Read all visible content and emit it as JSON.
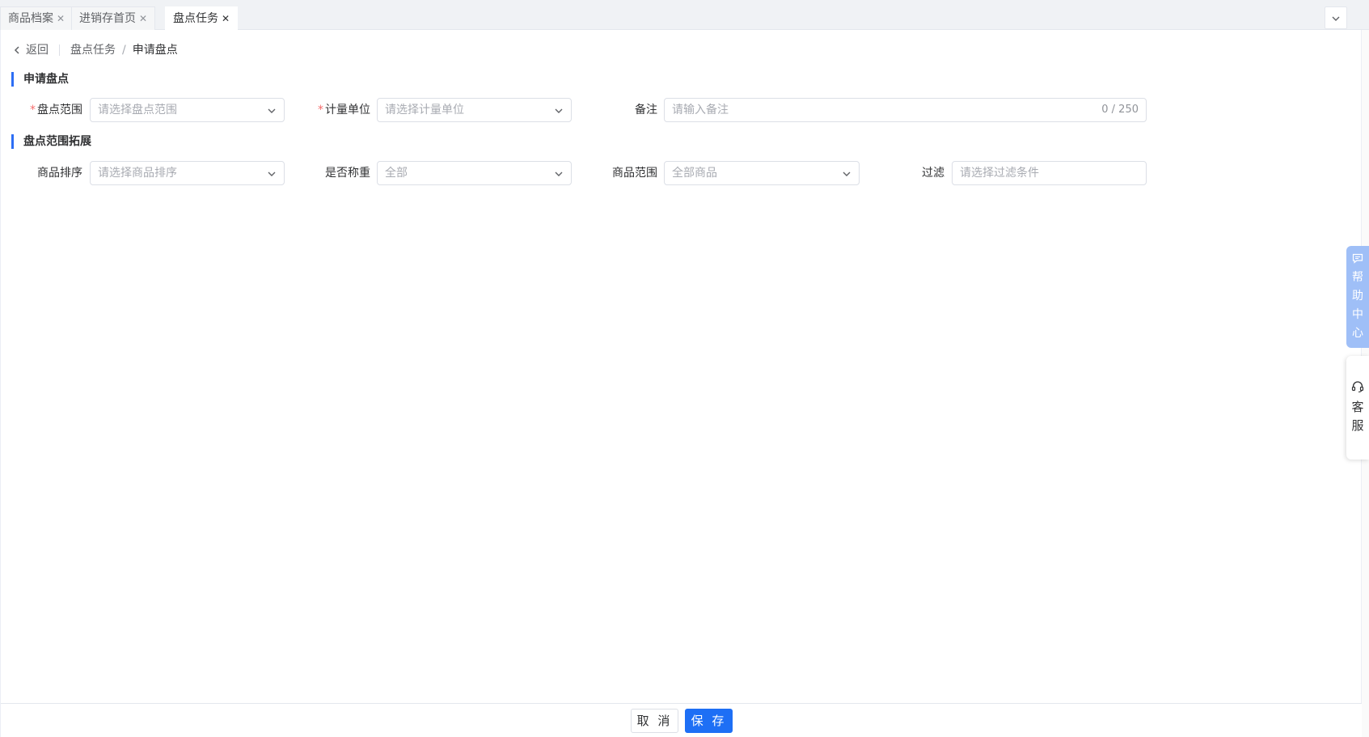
{
  "tabs": [
    {
      "label": "商品档案"
    },
    {
      "label": "进销存首页"
    },
    {
      "label": "盘点任务",
      "active": true
    }
  ],
  "breadcrumb": {
    "back_label": "返回",
    "parent": "盘点任务",
    "separator": "/",
    "current": "申请盘点"
  },
  "section1": {
    "title": "申请盘点",
    "scope": {
      "required_mark": "*",
      "label": "盘点范围",
      "placeholder": "请选择盘点范围"
    },
    "unit": {
      "required_mark": "*",
      "label": "计量单位",
      "placeholder": "请选择计量单位"
    },
    "remark": {
      "label": "备注",
      "placeholder": "请输入备注",
      "counter": "0 / 250"
    }
  },
  "section2": {
    "title": "盘点范围拓展",
    "sort": {
      "label": "商品排序",
      "placeholder": "请选择商品排序"
    },
    "weighed": {
      "label": "是否称重",
      "value": "全部"
    },
    "product_range": {
      "label": "商品范围",
      "value": "全部商品"
    },
    "filter": {
      "label": "过滤",
      "placeholder": "请选择过滤条件"
    }
  },
  "footer": {
    "cancel_label": "取 消",
    "save_label": "保 存"
  },
  "side_widgets": {
    "help": [
      "帮",
      "助",
      "中",
      "心"
    ],
    "service": [
      "客",
      "服"
    ]
  },
  "colors": {
    "primary": "#1e6ff5",
    "required": "#f56c6c",
    "help_widget": "#9fbff7"
  }
}
